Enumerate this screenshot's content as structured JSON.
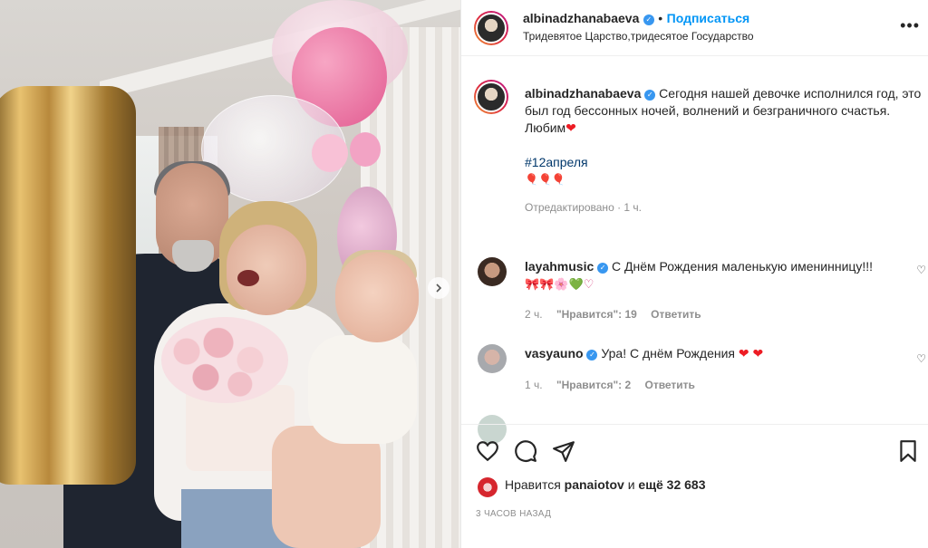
{
  "post": {
    "author": "albinadzhanabaeva",
    "follow_label": "Подписаться",
    "location": "Тридевятое Царство,тридесятое Государство",
    "more_icon": "more-dots-icon"
  },
  "caption": {
    "author": "albinadzhanabaeva",
    "text": "Сегодня нашей девочке исполнился год, это был год бессонных ночей, волнений и безграничного счастья.",
    "line2": "Любим",
    "line2_emoji": "❤",
    "hashtag": "#12апреля",
    "emoji_row": "🎈🎈🎈",
    "edited": "Отредактировано · 1 ч."
  },
  "comments": [
    {
      "author": "layahmusic",
      "verified": true,
      "text": "С Днём Рождения маленькую именинницу!!!",
      "emoji_line": "🎀🎀🌸💚♡",
      "time": "2 ч.",
      "likes": "\"Нравится\": 19",
      "reply": "Ответить"
    },
    {
      "author": "vasyauno",
      "verified": true,
      "text": "Ура! С днём Рождения",
      "emoji": "❤ ❤",
      "time": "1 ч.",
      "likes": "\"Нравится\": 2",
      "reply": "Ответить"
    }
  ],
  "likes": {
    "prefix": "Нравится",
    "user": "panaiotov",
    "and": "и",
    "count": "ещё 32 683"
  },
  "timestamp": "3 ЧАСОВ НАЗАД",
  "colors": {
    "link_blue": "#0095f6",
    "verified_blue": "#3897f0",
    "hashtag": "#00376b",
    "heart_red": "#ed1c24",
    "muted": "#8e8e8e"
  }
}
